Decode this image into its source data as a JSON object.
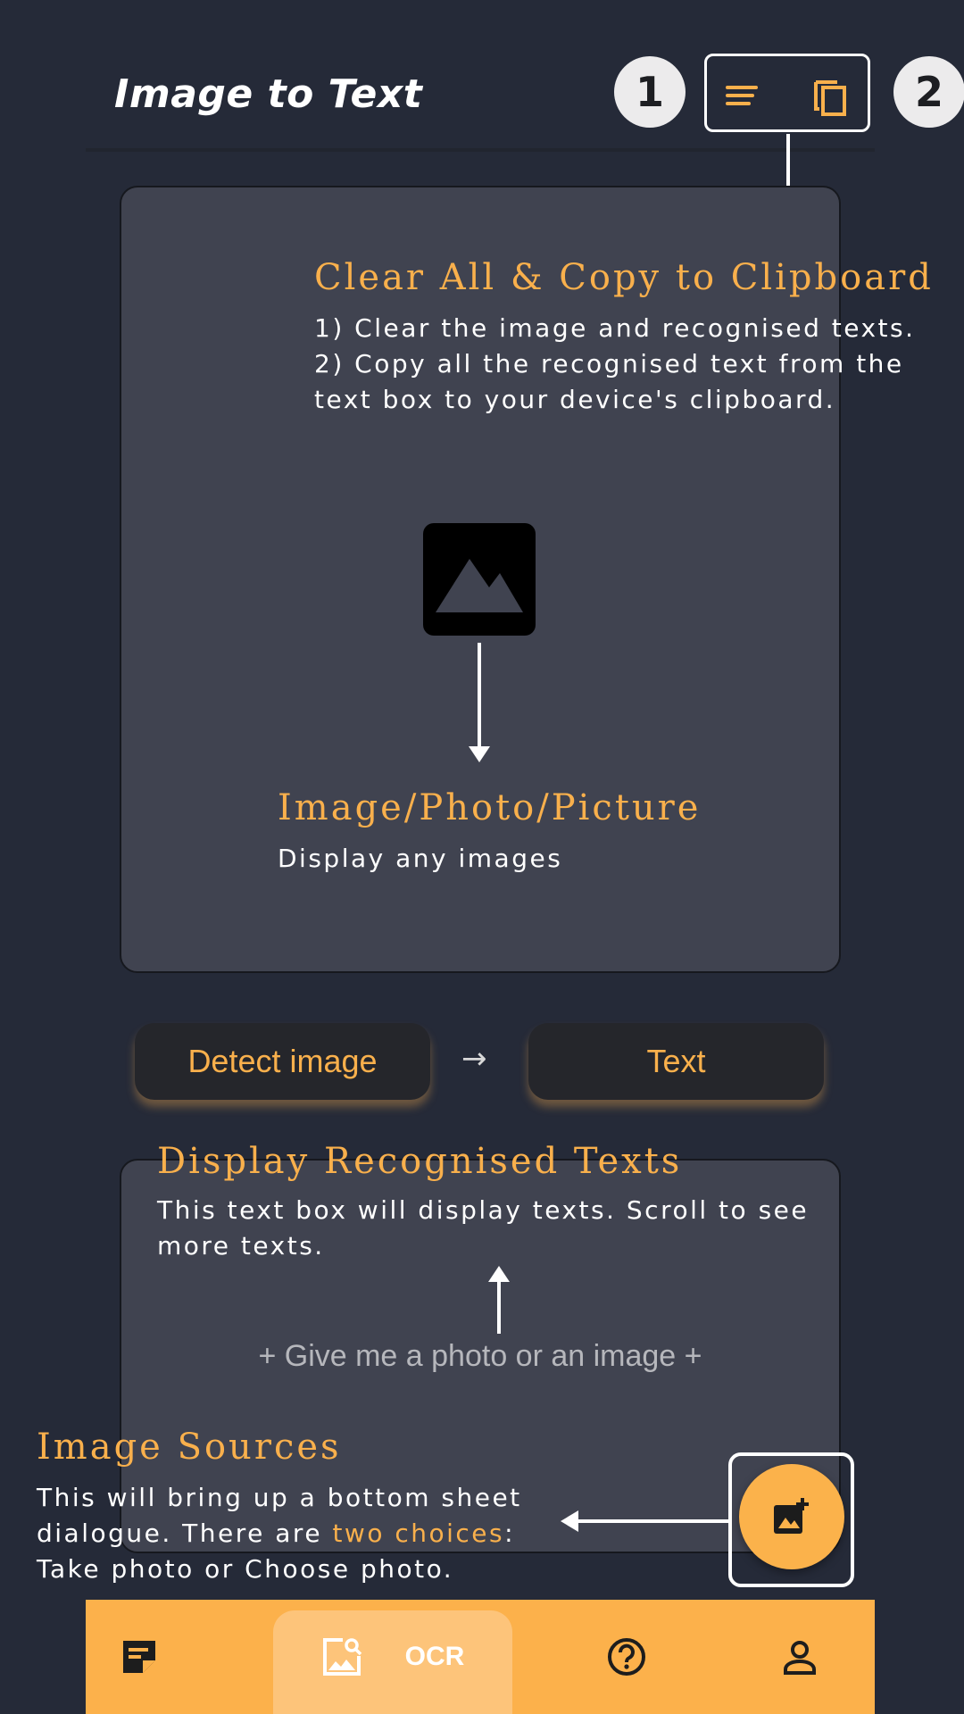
{
  "app": {
    "title": "Image to Text"
  },
  "toolbar": {
    "badge_1": "1",
    "badge_2": "2",
    "clear_all_icon": "clear-all-icon",
    "copy_icon": "copy-icon"
  },
  "hints": {
    "clear_copy": {
      "title": "Clear All & Copy to Clipboard",
      "line1": "1) Clear the image and recognised texts.",
      "line2": "2) Copy all the recognised text from the",
      "line3": "text box to your device's clipboard."
    },
    "image": {
      "title": "Image/Photo/Picture",
      "body": "Display any images"
    },
    "texts": {
      "title": "Display Recognised Texts",
      "line1": "This text box will display texts. Scroll to see",
      "line2": "more texts."
    },
    "sources": {
      "title": "Image Sources",
      "line1": "This will bring up a bottom sheet",
      "line2_pre": "dialogue. There are ",
      "line2_hl": "two choices",
      "line2_post": ":",
      "line3": "Take photo or Choose photo."
    }
  },
  "actions": {
    "detect_label": "Detect image",
    "arrow": "→",
    "text_label": "Text"
  },
  "text_box": {
    "placeholder": "+ Give me a photo or an image +"
  },
  "bottom_nav": {
    "items": [
      {
        "icon": "note-icon"
      },
      {
        "icon": "image-search-icon",
        "label": "OCR"
      },
      {
        "icon": "help-icon"
      },
      {
        "icon": "person-icon"
      }
    ]
  },
  "colors": {
    "background": "#252a38",
    "card": "#404350",
    "accent": "#f9b04c",
    "nav": "#fcb14b"
  }
}
